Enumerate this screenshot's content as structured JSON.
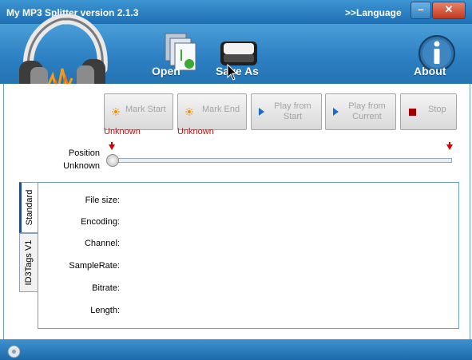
{
  "window": {
    "title": "My MP3 Splitter version 2.1.3",
    "language_link": ">>Language",
    "minimize_glyph": "–",
    "close_glyph": "✕"
  },
  "toolbar": {
    "open_label": "Open",
    "save_as_label": "Save As",
    "about_label": "About"
  },
  "controls": {
    "mark_start": {
      "label": "Mark Start"
    },
    "mark_end": {
      "label": "Mark End"
    },
    "play_from_start": {
      "line1": "Play from",
      "line2": "Start"
    },
    "play_from_current": {
      "line1": "Play from",
      "line2": "Current"
    },
    "stop": {
      "label": "Stop"
    },
    "mark_start_value": "Unknown",
    "mark_end_value": "Unknown"
  },
  "position": {
    "label": "Position",
    "value": "Unknown",
    "fraction": 0
  },
  "tabs": [
    {
      "label": "Standard",
      "active": true
    },
    {
      "label": "ID3Tags V1",
      "active": false
    }
  ],
  "info_fields": [
    {
      "label": "File size:"
    },
    {
      "label": "Encoding:"
    },
    {
      "label": "Channel:"
    },
    {
      "label": "SampleRate:"
    },
    {
      "label": "Bitrate:"
    },
    {
      "label": "Length:"
    }
  ],
  "icons": {
    "headphones": "headphones-icon",
    "open": "open-documents-icon",
    "save_as": "save-drive-icon",
    "about": "info-icon",
    "status": "disc-icon"
  },
  "colors": {
    "title_bar": "#2a80c4",
    "accent_red": "#d60000",
    "unknown_text": "#b01818",
    "disabled_text": "#a3a3a3"
  }
}
